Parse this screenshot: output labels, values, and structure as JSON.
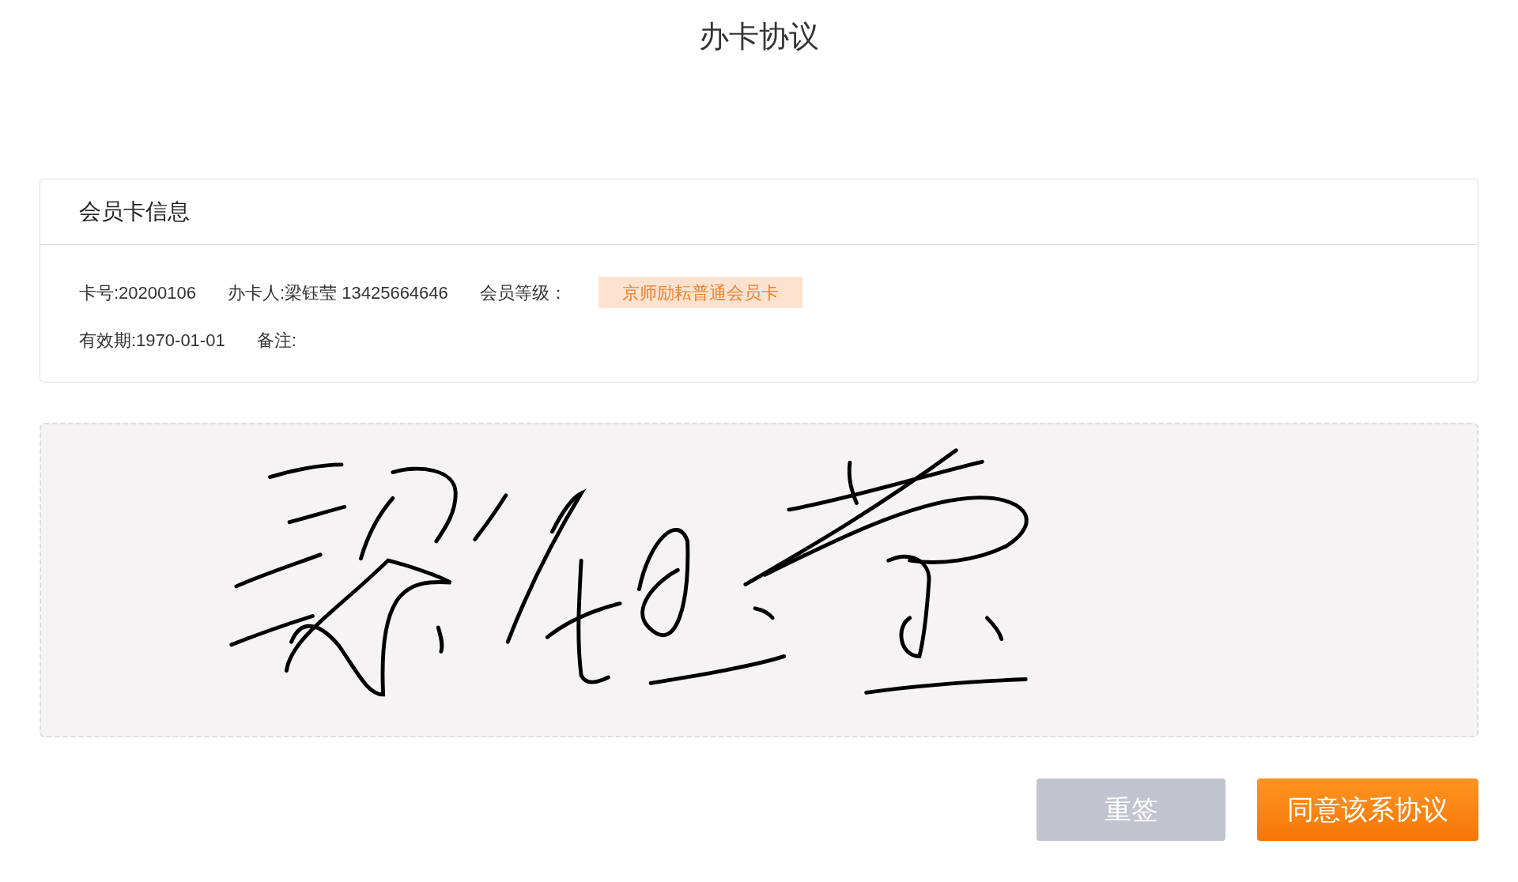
{
  "page": {
    "title": "办卡协议"
  },
  "card": {
    "title": "会员卡信息",
    "rows": [
      [
        {
          "kind": "text",
          "text": "卡号:20200106"
        },
        {
          "kind": "text",
          "text": "办卡人:梁钰莹 13425664646"
        },
        {
          "kind": "text",
          "text": "会员等级："
        },
        {
          "kind": "badge",
          "text": "京师励耘普通会员卡"
        }
      ],
      [
        {
          "kind": "text",
          "text": "有效期:1970-01-01"
        },
        {
          "kind": "text",
          "text": "备注:"
        }
      ]
    ]
  },
  "signature_pad": {
    "signed": true
  },
  "buttons": [
    {
      "kind": "secondary",
      "label": "重签"
    },
    {
      "kind": "primary",
      "label": "同意该系协议"
    }
  ]
}
